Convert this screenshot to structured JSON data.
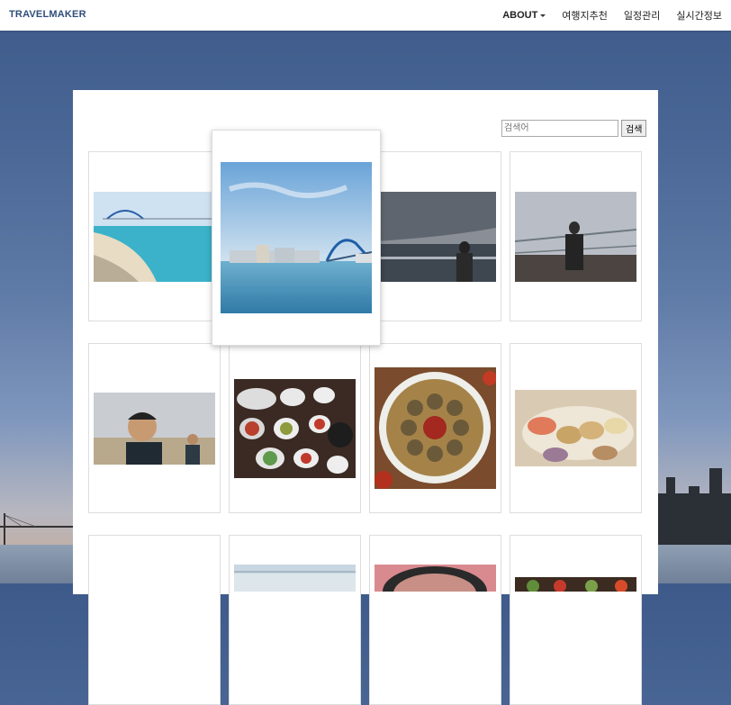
{
  "brand": "TRAVELMAKER",
  "nav": {
    "about": "ABOUT",
    "recommend": "여행지추천",
    "schedule": "일정관리",
    "realtime": "실시간정보"
  },
  "search": {
    "placeholder": "검색어",
    "button": "검색"
  },
  "gallery": {
    "items": [
      {
        "desc": "beach-with-bridge"
      },
      {
        "desc": "harbor-bridge"
      },
      {
        "desc": "person-at-sea-rail"
      },
      {
        "desc": "person-on-pier"
      },
      {
        "desc": "couple-selfie-beach"
      },
      {
        "desc": "korean-meal-table"
      },
      {
        "desc": "dumpling-plate"
      },
      {
        "desc": "seafood-platter"
      },
      {
        "desc": "empty"
      },
      {
        "desc": "beach-shore"
      },
      {
        "desc": "closeup-face"
      },
      {
        "desc": "vegetable-dish"
      }
    ],
    "featured": "harbor-bridge"
  }
}
